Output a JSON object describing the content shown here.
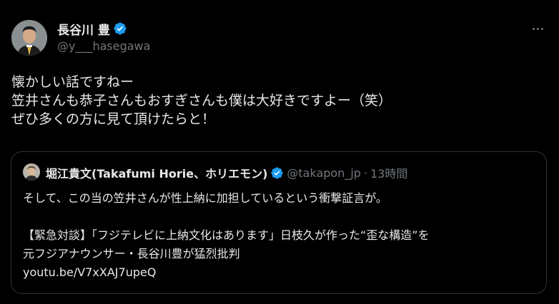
{
  "tweet": {
    "display_name": "長谷川 豊",
    "handle": "@y___hasegawa",
    "verified_icon": "verified-badge-icon",
    "more_icon": "more-horizontal-icon",
    "body_lines": [
      "懐かしい話ですねー",
      "笠井さんも恭子さんもおすぎさんも僕は大好きですよー（笑）",
      "ぜひ多くの方に見て頂けたらと！"
    ]
  },
  "quote": {
    "display_name": "堀江貴文(Takafumi Horie、ホリエモン)",
    "handle": "@takapon_jp",
    "separator": "·",
    "time": "13時間",
    "lines": [
      "そして、この当の笠井さんが性上納に加担しているという衝撃証言が。",
      "",
      "【緊急対談】「フジテレビに上納文化はあります」日枝久が作った“歪な構造”を",
      "元フジアナウンサー・長谷川豊が猛烈批判",
      "youtu.be/V7xXAJ7upeQ"
    ]
  },
  "colors": {
    "background": "#000000",
    "text_primary": "#e7e9ea",
    "text_secondary": "#71767b",
    "verified_blue": "#1d9bf0",
    "border": "#2f3336"
  }
}
